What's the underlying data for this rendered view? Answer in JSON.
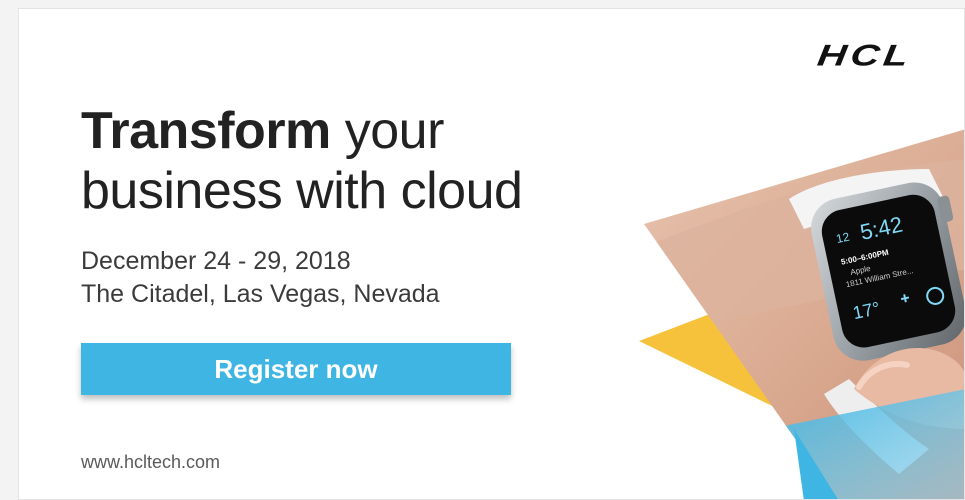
{
  "brand": {
    "logo_text": "HCL"
  },
  "headline": {
    "bold": "Transform",
    "rest_line1": " your",
    "line2": "business with cloud"
  },
  "event": {
    "date": "December 24 - 29, 2018",
    "venue": "The Citadel, Las Vegas, Nevada"
  },
  "cta": {
    "label": "Register now"
  },
  "footer": {
    "url": "www.hcltech.com"
  },
  "watch": {
    "time_small": "12",
    "time": "5:42",
    "event_time": "5:00–6:00PM",
    "event_name": "Apple",
    "address": "1811 William Stre...",
    "temperature": "17°"
  },
  "colors": {
    "accent_blue": "#3eb5e2",
    "accent_yellow": "#f6c23c",
    "text_dark": "#222222",
    "logo": "#111111"
  }
}
